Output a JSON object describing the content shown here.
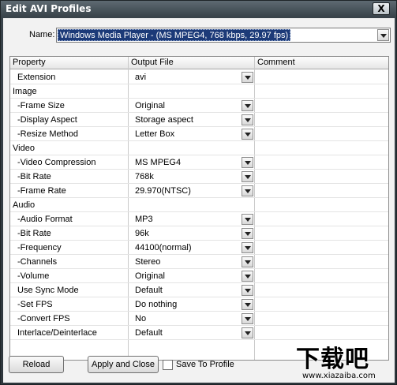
{
  "window": {
    "title": "Edit AVI Profiles",
    "close_glyph": "X"
  },
  "name": {
    "label": "Name:",
    "value": "Windows Media Player - (MS MPEG4, 768 kbps, 29.97 fps)"
  },
  "table": {
    "headers": [
      "Property",
      "Output File",
      "Comment"
    ],
    "rows": [
      {
        "property": "Extension",
        "value": "avi",
        "dropdown": true
      },
      {
        "property": "Image",
        "value": "",
        "dropdown": false
      },
      {
        "property": "-Frame Size",
        "value": "Original",
        "dropdown": true
      },
      {
        "property": "-Display Aspect",
        "value": "Storage aspect",
        "dropdown": true
      },
      {
        "property": "-Resize Method",
        "value": "Letter Box",
        "dropdown": true
      },
      {
        "property": "Video",
        "value": "",
        "dropdown": false
      },
      {
        "property": "-Video Compression",
        "value": "MS MPEG4",
        "dropdown": true
      },
      {
        "property": "-Bit Rate",
        "value": "768k",
        "dropdown": true
      },
      {
        "property": "-Frame Rate",
        "value": "29.970(NTSC)",
        "dropdown": true
      },
      {
        "property": "Audio",
        "value": "",
        "dropdown": false
      },
      {
        "property": "-Audio Format",
        "value": "MP3",
        "dropdown": true
      },
      {
        "property": "-Bit Rate",
        "value": "96k",
        "dropdown": true
      },
      {
        "property": "-Frequency",
        "value": "44100(normal)",
        "dropdown": true
      },
      {
        "property": "-Channels",
        "value": "Stereo",
        "dropdown": true
      },
      {
        "property": "-Volume",
        "value": "Original",
        "dropdown": true
      },
      {
        "property": "Use Sync Mode",
        "value": "Default",
        "dropdown": true
      },
      {
        "property": "-Set FPS",
        "value": "Do nothing",
        "dropdown": true
      },
      {
        "property": "-Convert FPS",
        "value": "No",
        "dropdown": true
      },
      {
        "property": "Interlace/Deinterlace",
        "value": "Default",
        "dropdown": true
      }
    ]
  },
  "buttons": {
    "reload": "Reload",
    "apply_close": "Apply and Close",
    "save_to_profile": "Save To Profile"
  },
  "watermark": {
    "logo": "下载吧",
    "url": "www.xiazaiba.com"
  }
}
